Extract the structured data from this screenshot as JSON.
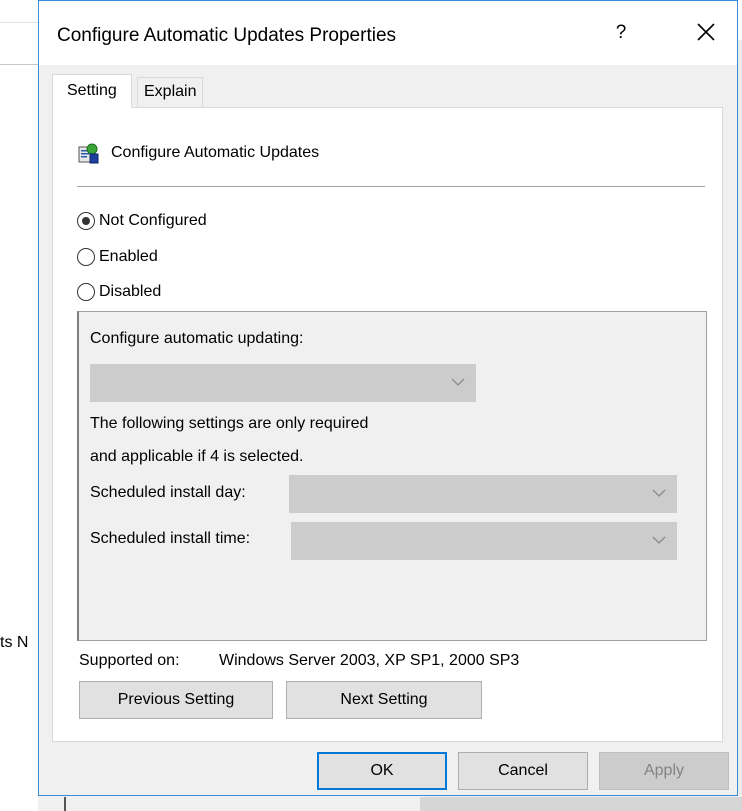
{
  "background": {
    "fragment_text": "ts N"
  },
  "dialog": {
    "title": "Configure Automatic Updates Properties",
    "help_label": "?",
    "tabs": [
      {
        "label": "Setting",
        "active": true
      },
      {
        "label": "Explain",
        "active": false
      }
    ],
    "policy_name": "Configure Automatic Updates",
    "policy_icon": "policy-setting-icon",
    "radios": [
      {
        "label": "Not Configured",
        "checked": true
      },
      {
        "label": "Enabled",
        "checked": false
      },
      {
        "label": "Disabled",
        "checked": false
      }
    ],
    "options": {
      "configure_label": "Configure automatic updating:",
      "configure_value": "",
      "note_line1": "The following settings are only required",
      "note_line2": "and applicable if 4 is selected.",
      "install_day_label": "Scheduled install day:",
      "install_day_value": "",
      "install_time_label": "Scheduled install time:",
      "install_time_value": ""
    },
    "supported_label": "Supported on:",
    "supported_value": "Windows Server 2003, XP SP1, 2000 SP3",
    "nav_buttons": {
      "previous": "Previous Setting",
      "next": "Next Setting"
    },
    "footer_buttons": {
      "ok": "OK",
      "cancel": "Cancel",
      "apply": "Apply"
    }
  },
  "colors": {
    "accent": "#0078d7",
    "window_border": "#3a8bd1",
    "disabled_fill": "#cccccc"
  }
}
